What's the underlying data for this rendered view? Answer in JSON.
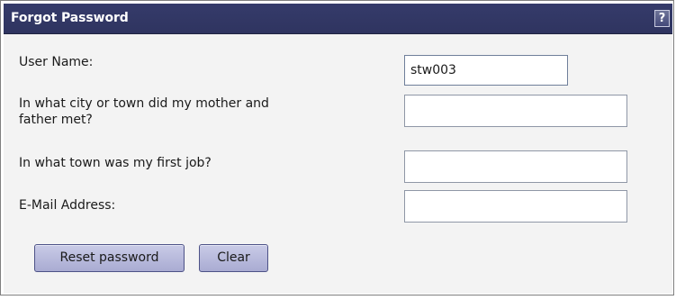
{
  "dialog": {
    "title": "Forgot Password",
    "help_label": "?"
  },
  "form": {
    "username_label": "User Name:",
    "username_value": "stw003",
    "q1_label_line1": "In what city or town did my mother and",
    "q1_label_line2": "father met?",
    "q1_value": "",
    "q2_label": "In what town was my first job?",
    "q2_value": "",
    "email_label": "E-Mail Address:",
    "email_value": ""
  },
  "buttons": {
    "reset_label": "Reset password",
    "clear_label": "Clear"
  },
  "colors": {
    "titlebar": "#353b6a",
    "button_fill": "#b9bbe0",
    "form_bg": "#f3f3f3"
  }
}
